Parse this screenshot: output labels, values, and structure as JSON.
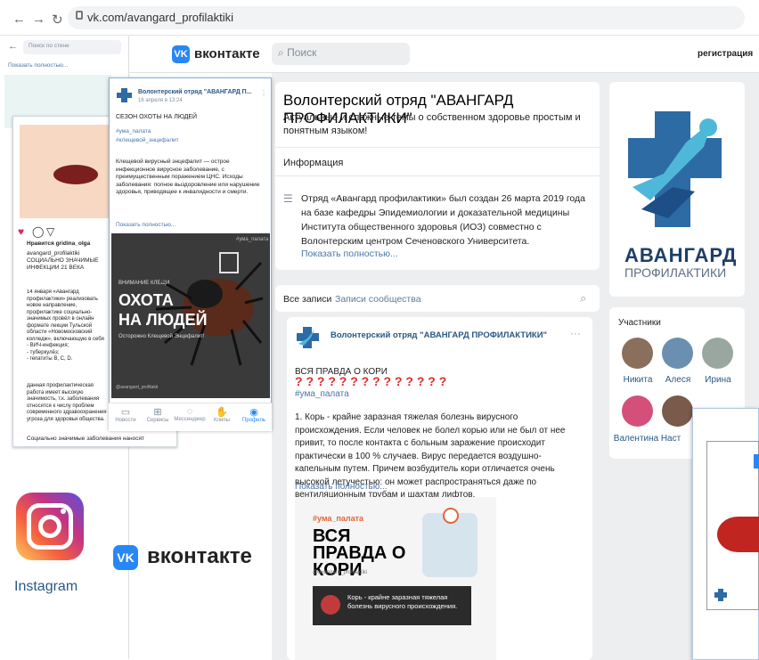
{
  "browser": {
    "url": "vk.com/avangard_profilaktiki"
  },
  "vk_header": {
    "brand": "вконтакте",
    "search_placeholder": "Поиск",
    "register": "регистрация"
  },
  "group": {
    "name": "Волонтерский отряд \"АВАНГАРД ПРОФИЛАКТИКИ\"",
    "status": "Актуальные и сложные темы о собственном здоровье простым и понятным языком!",
    "info_title": "Информация",
    "info_text": "Отряд «Авангард профилактики» был создан 26 марта 2019 года на базе кафедры Эпидемиологии и доказательной медицины Института общественного здоровья (ИОЗ) совместно с Волонтерским центром Сеченовского Университета.",
    "show_more": "Показать полностью...",
    "logo_line1": "АВАНГАРД",
    "logo_line2": "ПРОФИЛАКТИКИ"
  },
  "wall": {
    "tab_all": "Все записи",
    "tab_community": "Записи сообщества"
  },
  "post": {
    "author": "Волонтерский отряд \"АВАНГАРД ПРОФИЛАКТИКИ\"",
    "title": "ВСЯ ПРАВДА О КОРИ",
    "questions": "? ? ? ? ? ? ? ? ? ? ? ? ? ?",
    "hashtag": "#ума_палата",
    "text": "1. Корь - крайне заразная тяжелая болезнь вирусного происхождения. Если человек не болел корью или не был от нее привит, то после контакта с больным заражение происходит практически в 100 % случаев. Вирус передается воздушно-капельным путем. Причем возбудитель кори отличается очень высокой летучестью: он может распространяться даже по вентиляционным трубам и шахтам лифтов.",
    "show_more": "Показать полностью...",
    "img_hashtag": "#ума_палата",
    "img_title": "ВСЯ ПРАВДА О КОРИ",
    "img_handle": "@avangard_profilaktiki",
    "img_caption": "Корь - крайне заразная тяжелая болезнь вирусного происхождения."
  },
  "members": {
    "title": "Участники",
    "list": [
      {
        "name": "Никита",
        "color": "#8a6f5c"
      },
      {
        "name": "Алеся",
        "color": "#6b8fb0"
      },
      {
        "name": "Ирина",
        "color": "#9aa7a0"
      },
      {
        "name": "Валентина",
        "color": "#d4507a"
      },
      {
        "name": "Наст",
        "color": "#7a5a4a"
      }
    ]
  },
  "phone_left": {
    "search": "Поиск по стене",
    "show_more": "Показать полностью..."
  },
  "instagram_post": {
    "likes": "Нравится gridina_olga",
    "account": "avangard_profilaktiki СОЦИАЛЬНО ЗНАЧИМЫЕ ИНФЕКЦИИ 21 ВЕКА",
    "body": "14 января «Авангард профилактики» реализовать новое направление, профилактике социально-значимых провёл в онлайн формате лекции Тульской области «Новомосковский колледж», включающую в себя заболевания:",
    "items": [
      "- ВИЧ-инфекция;",
      "- туберкулёз;",
      "- гепатиты B, C, D."
    ],
    "note": "Данная профилактическая работа имеет высокую значимость, т.к. заболевания относятся к числу проблем современного здравоохранения угроза для здоровья общества.",
    "footer": "Социально значимые заболевания наносят"
  },
  "phone_post": {
    "author": "Волонтерский отряд \"АВАНГАРД П...",
    "date": "16 апреля в 13:24",
    "heading": "СЕЗОН ОХОТЫ НА ЛЮДЕЙ",
    "tag1": "#ума_палата",
    "tag2": "#клещевой_энцефалит",
    "text": "Клещевой вирусный энцефалит — острое инфекционное вирусное заболевание, с преимущественным поражением ЦНС. Исходы заболевания: полное выздоровление или нарушение здоровья, приводящее к инвалидности и смерти.",
    "show_more": "Показать полностью...",
    "img_small": "ВНИМАНИЕ КЛЕЩИ",
    "img_title1": "ОХОТА",
    "img_title2": "НА ЛЮДЕЙ",
    "img_sub": "Осторожно Клещевой Энцефалит!",
    "img_tag": "#ума_палата",
    "img_handle": "@avangard_profilakti",
    "nav": [
      "Новости",
      "Сервисы",
      "Мессенджер",
      "Клипы",
      "Профиль"
    ]
  },
  "logos": {
    "instagram": "Instagram",
    "vk": "вконтакте"
  }
}
